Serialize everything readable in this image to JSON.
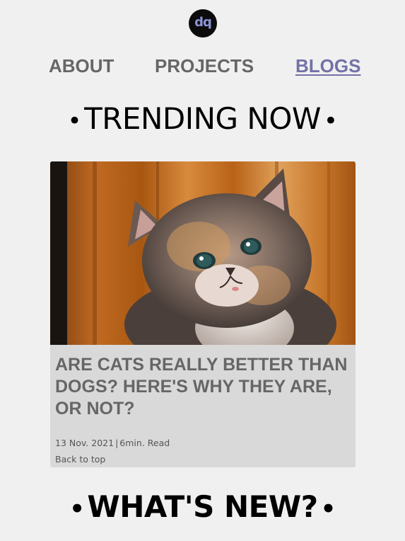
{
  "header": {
    "logo_text": "dq"
  },
  "nav": {
    "items": [
      {
        "label": "ABOUT",
        "active": false
      },
      {
        "label": "PROJECTS",
        "active": false
      },
      {
        "label": "BLOGS",
        "active": true
      }
    ],
    "active_color": "#7371a8",
    "inactive_color": "#666666"
  },
  "sections": {
    "trending": {
      "bullet_left": "•",
      "title": "TRENDING NOW",
      "bullet_right": "•"
    },
    "whats_new": {
      "bullet_left": "•",
      "title": "WHAT'S NEW?",
      "bullet_right": "•"
    }
  },
  "featured_post": {
    "image_subject": "kitten",
    "title": "ARE CATS REALLY BETTER THAN DOGS? HERE'S WHY THEY ARE, OR NOT?",
    "date": "13 Nov. 2021",
    "separator": "|",
    "read_time": "6min. Read",
    "back_to_top": "Back to top"
  }
}
